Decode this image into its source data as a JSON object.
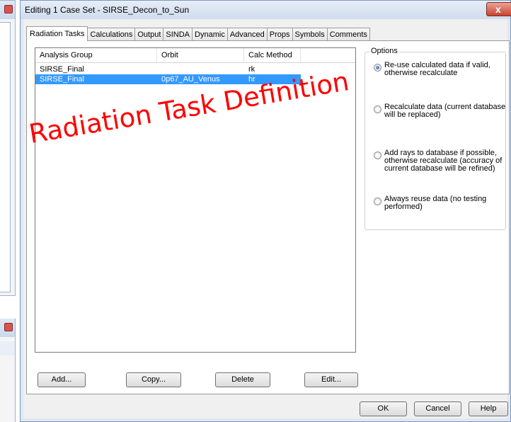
{
  "dialog": {
    "title": "Editing 1 Case Set - SIRSE_Decon_to_Sun",
    "close_glyph": "x"
  },
  "tabs": [
    {
      "label": "Radiation Tasks",
      "active": true
    },
    {
      "label": "Calculations",
      "active": false
    },
    {
      "label": "Output",
      "active": false
    },
    {
      "label": "SINDA",
      "active": false
    },
    {
      "label": "Dynamic",
      "active": false
    },
    {
      "label": "Advanced",
      "active": false
    },
    {
      "label": "Props",
      "active": false
    },
    {
      "label": "Symbols",
      "active": false
    },
    {
      "label": "Comments",
      "active": false
    }
  ],
  "list": {
    "columns": [
      "Analysis Group",
      "Orbit",
      "Calc Method"
    ],
    "rows": [
      {
        "group": "SIRSE_Final",
        "orbit": "",
        "method": "rk",
        "selected": false
      },
      {
        "group": "SIRSE_Final",
        "orbit": "0p67_AU_Venus",
        "method": "hr",
        "selected": true
      }
    ]
  },
  "panel_buttons": {
    "add": "Add...",
    "copy": "Copy...",
    "delete": "Delete",
    "edit": "Edit..."
  },
  "options": {
    "title": "Options",
    "items": [
      {
        "label": "Re-use calculated data if valid, otherwise recalculate",
        "checked": true
      },
      {
        "label": "Recalculate data (current database will be replaced)",
        "checked": false
      },
      {
        "label": "Add rays to database if possible, otherwise recalculate (accuracy of current database will be refined)",
        "checked": false
      },
      {
        "label": "Always reuse data (no testing performed)",
        "checked": false
      }
    ]
  },
  "footer_buttons": {
    "ok": "OK",
    "cancel": "Cancel",
    "help": "Help"
  },
  "overlay": {
    "text": "Radiation Task Definition",
    "color": "#ff0000"
  },
  "colors": {
    "selection": "#3399ff",
    "close_button": "#c7432f"
  }
}
